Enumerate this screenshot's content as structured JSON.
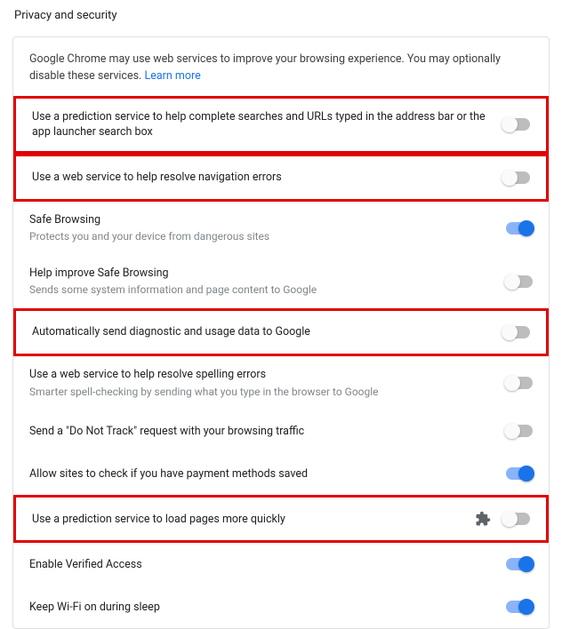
{
  "page": {
    "title": "Privacy and security"
  },
  "intro": {
    "text": "Google Chrome may use web services to improve your browsing experience. You may optionally disable these services.",
    "learn_more": "Learn more"
  },
  "settings": [
    {
      "id": "prediction-search",
      "title": "Use a prediction service to help complete searches and URLs typed in the address bar or the app launcher search box",
      "sub": "",
      "on": false,
      "highlight": true,
      "ext": false
    },
    {
      "id": "nav-error",
      "title": "Use a web service to help resolve navigation errors",
      "sub": "",
      "on": false,
      "highlight": true,
      "ext": false
    },
    {
      "id": "safe-browsing",
      "title": "Safe Browsing",
      "sub": "Protects you and your device from dangerous sites",
      "on": true,
      "highlight": false,
      "ext": false
    },
    {
      "id": "help-safe-browsing",
      "title": "Help improve Safe Browsing",
      "sub": "Sends some system information and page content to Google",
      "on": false,
      "highlight": false,
      "ext": false
    },
    {
      "id": "diagnostic",
      "title": "Automatically send diagnostic and usage data to Google",
      "sub": "",
      "on": false,
      "highlight": true,
      "ext": false
    },
    {
      "id": "spelling",
      "title": "Use a web service to help resolve spelling errors",
      "sub": "Smarter spell-checking by sending what you type in the browser to Google",
      "on": false,
      "highlight": false,
      "ext": false
    },
    {
      "id": "dnt",
      "title": "Send a \"Do Not Track\" request with your browsing traffic",
      "sub": "",
      "on": false,
      "highlight": false,
      "ext": false
    },
    {
      "id": "payment",
      "title": "Allow sites to check if you have payment methods saved",
      "sub": "",
      "on": true,
      "highlight": false,
      "ext": false
    },
    {
      "id": "prediction-load",
      "title": "Use a prediction service to load pages more quickly",
      "sub": "",
      "on": false,
      "highlight": true,
      "ext": true
    },
    {
      "id": "verified-access",
      "title": "Enable Verified Access",
      "sub": "",
      "on": true,
      "highlight": false,
      "ext": false
    },
    {
      "id": "wifi-sleep",
      "title": "Keep Wi-Fi on during sleep",
      "sub": "",
      "on": true,
      "highlight": false,
      "ext": false
    }
  ]
}
